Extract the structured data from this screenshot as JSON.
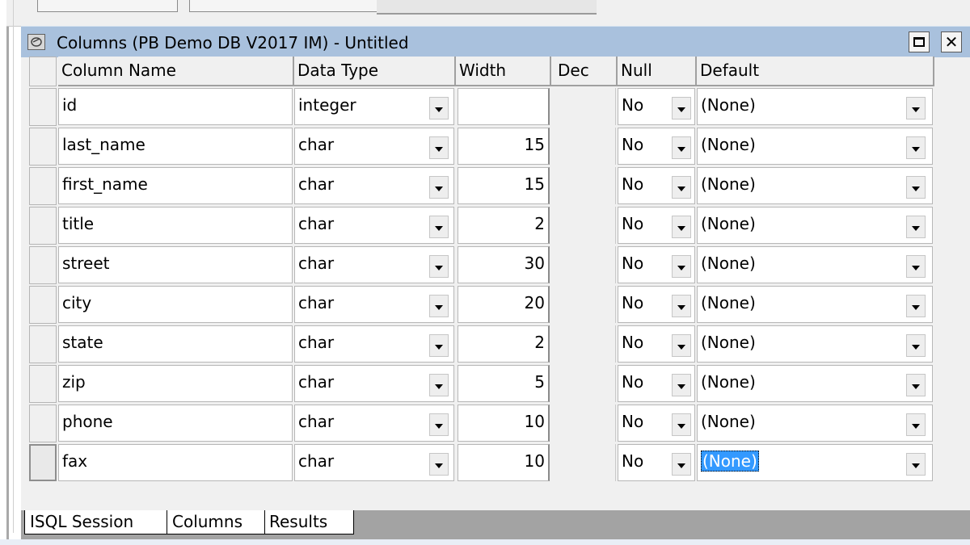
{
  "window": {
    "title": "Columns (PB Demo DB V2017 IM) - Untitled"
  },
  "grid": {
    "headers": {
      "column_name": "Column Name",
      "data_type": "Data Type",
      "width": "Width",
      "dec": "Dec",
      "null": "Null",
      "default": "Default"
    },
    "rows": [
      {
        "name": "id",
        "type": "integer",
        "width": "",
        "null": "No",
        "default": "(None)"
      },
      {
        "name": "last_name",
        "type": "char",
        "width": "15",
        "null": "No",
        "default": "(None)"
      },
      {
        "name": "first_name",
        "type": "char",
        "width": "15",
        "null": "No",
        "default": "(None)"
      },
      {
        "name": "title",
        "type": "char",
        "width": "2",
        "null": "No",
        "default": "(None)"
      },
      {
        "name": "street",
        "type": "char",
        "width": "30",
        "null": "No",
        "default": "(None)"
      },
      {
        "name": "city",
        "type": "char",
        "width": "20",
        "null": "No",
        "default": "(None)"
      },
      {
        "name": "state",
        "type": "char",
        "width": "2",
        "null": "No",
        "default": "(None)"
      },
      {
        "name": "zip",
        "type": "char",
        "width": "5",
        "null": "No",
        "default": "(None)"
      },
      {
        "name": "phone",
        "type": "char",
        "width": "10",
        "null": "No",
        "default": "(None)"
      },
      {
        "name": "fax",
        "type": "char",
        "width": "10",
        "null": "No",
        "default": "(None)"
      }
    ],
    "selected_row": 9
  },
  "tabs": [
    {
      "label": "ISQL Session",
      "active": false
    },
    {
      "label": "Columns",
      "active": true
    },
    {
      "label": "Results",
      "active": false
    }
  ],
  "colors": {
    "titlebar": "#a9c1dd",
    "selection": "#3399ff"
  }
}
